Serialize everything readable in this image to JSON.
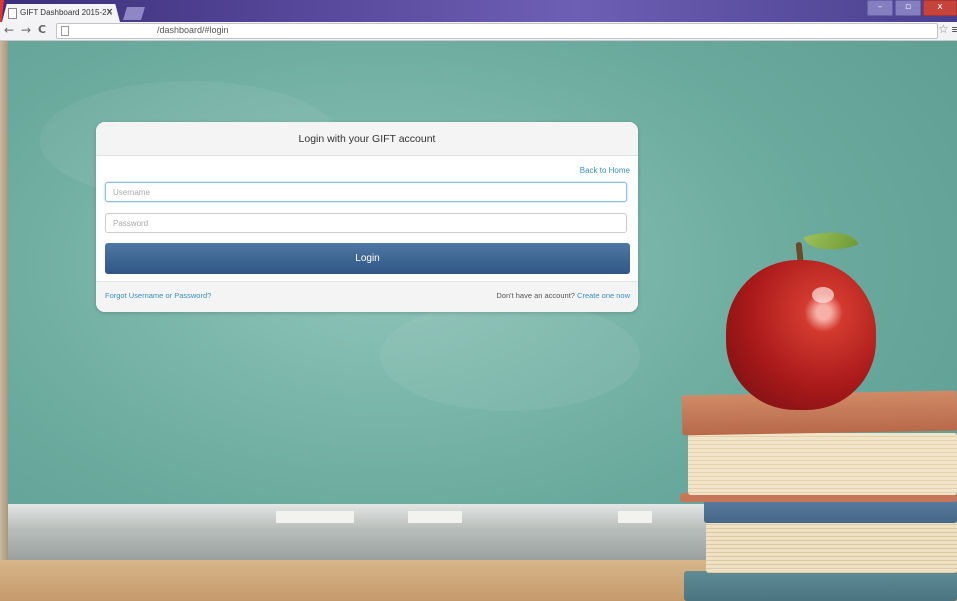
{
  "browser": {
    "tab_title": "GIFT Dashboard 2015-2X",
    "tab_close": "×",
    "url": "/dashboard/#login",
    "back_glyph": "←",
    "forward_glyph": "→",
    "reload_glyph": "C",
    "star_glyph": "☆",
    "menu_glyph": "≡",
    "window_buttons": {
      "minimize": "–",
      "maximize": "▫",
      "close": "x"
    }
  },
  "login": {
    "heading": "Login with your GIFT account",
    "back_home": "Back to Home",
    "username_placeholder": "Username",
    "password_placeholder": "Password",
    "login_button": "Login",
    "forgot": "Forgot Username or Password?",
    "no_account": "Don't have an account?",
    "create_account": "Create one now"
  },
  "colors": {
    "primary_button": "#2f5685",
    "link": "#3a8fbf",
    "chalkboard": "#6aa99d"
  },
  "icons": [
    "page-icon",
    "back-arrow-icon",
    "forward-arrow-icon",
    "reload-icon",
    "star-icon",
    "menu-icon"
  ]
}
